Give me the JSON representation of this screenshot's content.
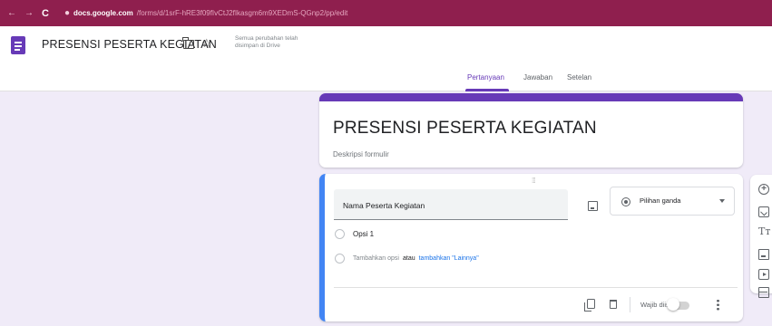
{
  "browser": {
    "url_host": "docs.google.com",
    "url_path": "/forms/d/1srF-hRE3f09fIvCtJ2fIkasgm6m9XEDmS-QGnp2/pp/edit"
  },
  "header": {
    "title": "PRESENSI PESERTA KEGIATAN",
    "save_status": "Semua perubahan telah disimpan di Drive"
  },
  "tabs": [
    {
      "label": "Pertanyaan",
      "active": true
    },
    {
      "label": "Jawaban",
      "active": false
    },
    {
      "label": "Setelan",
      "active": false
    }
  ],
  "form": {
    "title": "PRESENSI PESERTA KEGIATAN",
    "description": "Deskripsi formulir"
  },
  "question": {
    "text": "Nama Peserta Kegiatan",
    "type": "Pilihan ganda",
    "options": [
      "Opsi 1"
    ],
    "add_option": "Tambahkan opsi",
    "add_or": "atau",
    "add_other": "tambahkan \"Lainnya\"",
    "required_label": "Wajib diisi",
    "required": false
  },
  "colors": {
    "browser_bar": "#8f1f4e",
    "theme_accent": "#673ab7",
    "active_question": "#4285f4",
    "page_background": "#f0ebf8"
  },
  "toolbar": [
    "add-question-icon",
    "import-questions-icon",
    "add-title-icon",
    "add-image-icon",
    "add-video-icon",
    "add-section-icon"
  ]
}
